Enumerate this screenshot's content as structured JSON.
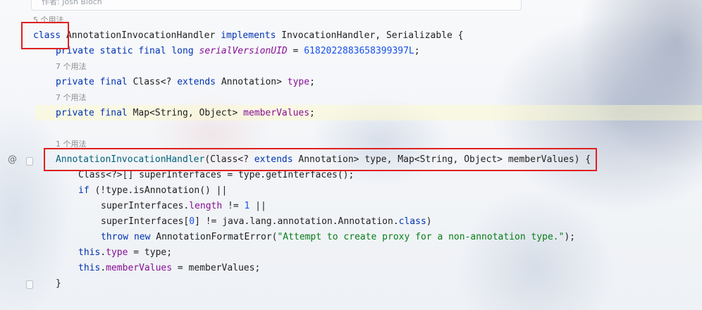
{
  "tooltip": {
    "author": "作者: Josh Bloch"
  },
  "hints": {
    "usages_5": "5 个用法",
    "usages_7a": "7 个用法",
    "usages_7b": "7 个用法",
    "usages_1": "1 个用法"
  },
  "code": {
    "l1": {
      "kw": "class",
      "name": " AnnotationInvocationHandler ",
      "kw2": "implements",
      "rest": " InvocationHandler, Serializable {"
    },
    "l2": {
      "kw": "private static final long ",
      "field": "serialVersionUID",
      "eq": " = ",
      "num": "6182022883658399397L",
      "end": ";"
    },
    "l3": {
      "kw": "private final ",
      "t1": "Class<? ",
      "kw2": "extends",
      "t2": " Annotation> ",
      "field": "type",
      "end": ";"
    },
    "l4": {
      "kw": "private final ",
      "t1": "Map<String, Object> ",
      "field": "memberValues",
      "end": ";"
    },
    "l5": {
      "ctor": "AnnotationInvocationHandler",
      "p1": "(Class<? ",
      "kw": "extends",
      "p2": " Annotation> type, Map<String, Object> memberValues) {"
    },
    "l6": {
      "text": "Class<?>[] superInterfaces = type.getInterfaces();"
    },
    "l7": {
      "kw": "if",
      "text": " (!type.isAnnotation() ||"
    },
    "l8": {
      "t1": "superInterfaces.",
      "field": "length",
      "t2": " != ",
      "num": "1",
      "t3": " ||"
    },
    "l9": {
      "t1": "superInterfaces[",
      "num": "0",
      "t2": "] != java.lang.annotation.Annotation.",
      "kw": "class",
      "t3": ")"
    },
    "l10": {
      "kw": "throw new",
      "t1": " AnnotationFormatError(",
      "str": "\"Attempt to create proxy for a non-annotation type.\"",
      "t2": ");"
    },
    "l11": {
      "kw": "this",
      "t1": ".",
      "field": "type",
      "t2": " = type;"
    },
    "l12": {
      "kw": "this",
      "t1": ".",
      "field": "memberValues",
      "t2": " = memberValues;"
    },
    "l13": {
      "text": "}"
    }
  },
  "gutter": {
    "at_symbol": "@"
  },
  "colors": {
    "annotation_box": "#e02020"
  }
}
